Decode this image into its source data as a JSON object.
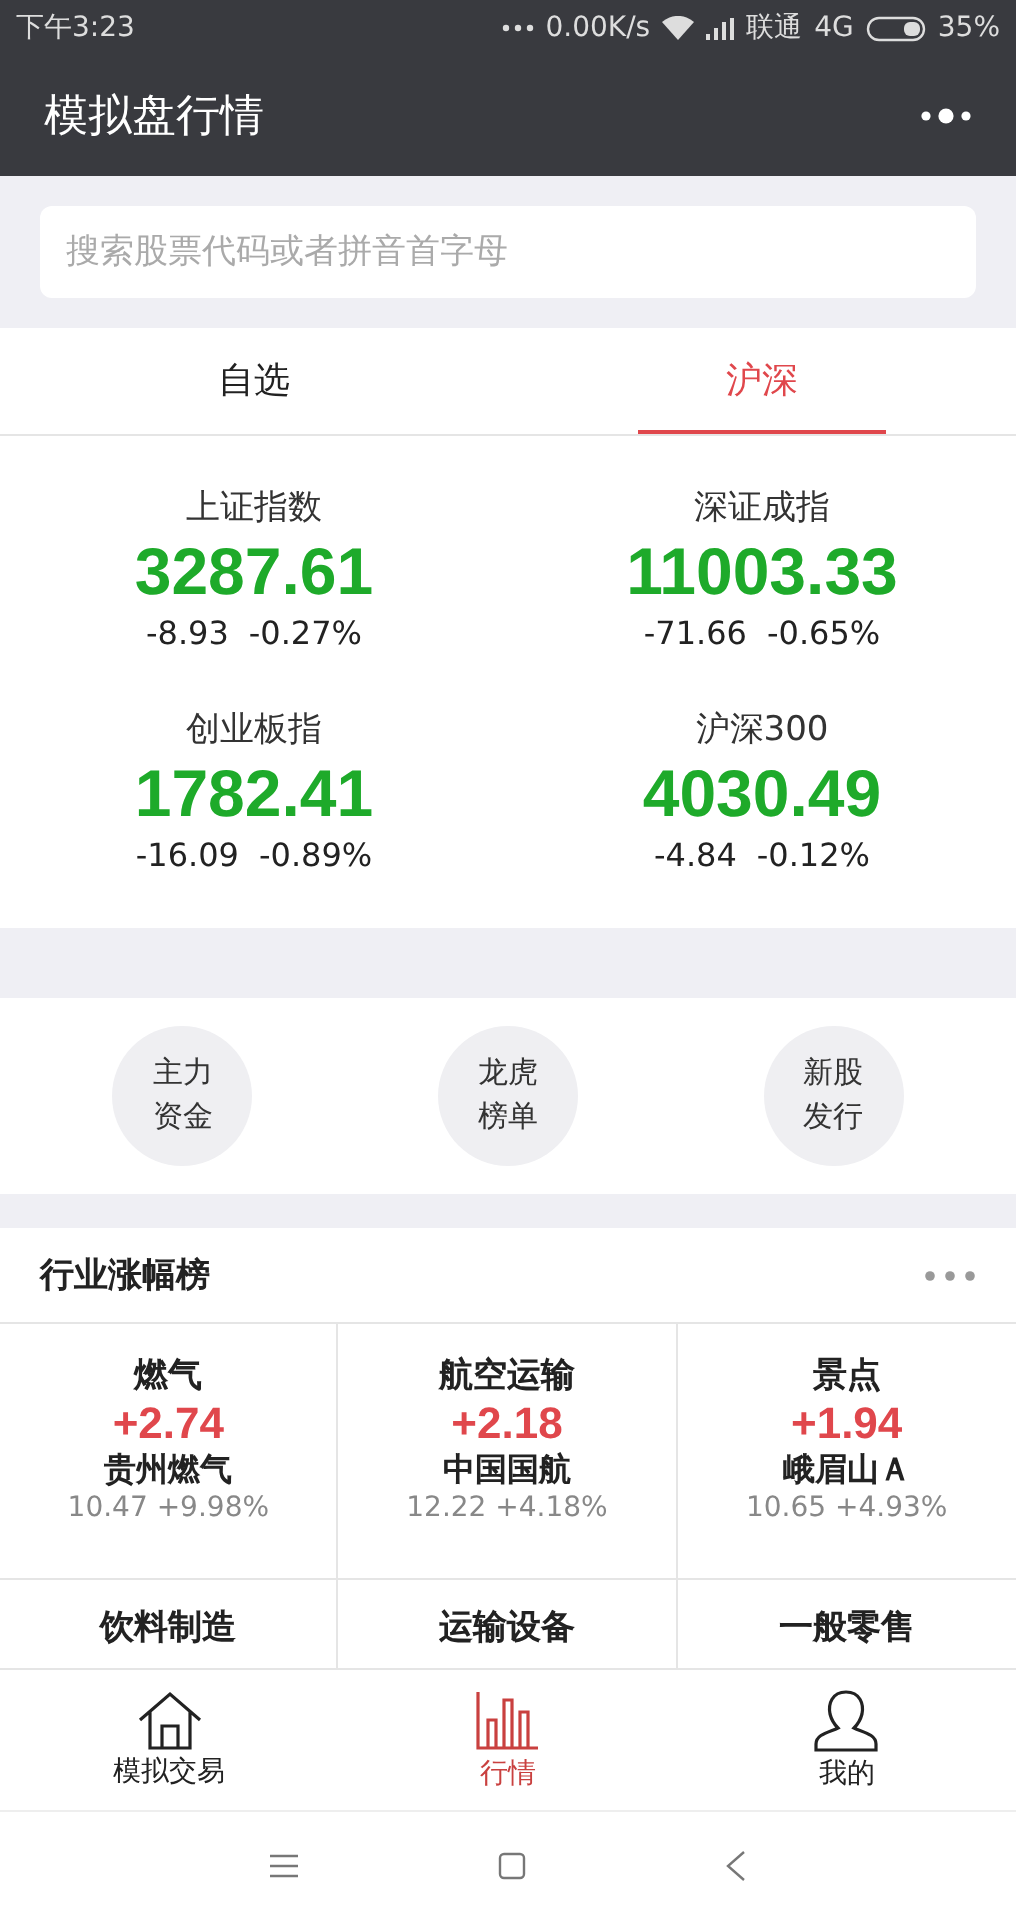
{
  "status_bar": {
    "time": "下午3:23",
    "speed": "0.00K/s",
    "carrier": "联通",
    "network": "4G",
    "battery": "35%"
  },
  "window": {
    "title": "模拟盘行情"
  },
  "search": {
    "placeholder": "搜索股票代码或者拼音首字母"
  },
  "tabs": [
    {
      "label": "自选",
      "selected": false
    },
    {
      "label": "沪深",
      "selected": true
    }
  ],
  "indices": [
    {
      "name": "上证指数",
      "value": "3287.61",
      "change": "-8.93",
      "percent": "-0.27%",
      "color": "#1eaa2a"
    },
    {
      "name": "深证成指",
      "value": "11003.33",
      "change": "-71.66",
      "percent": "-0.65%",
      "color": "#1eaa2a"
    },
    {
      "name": "创业板指",
      "value": "1782.41",
      "change": "-16.09",
      "percent": "-0.89%",
      "color": "#1eaa2a"
    },
    {
      "name": "沪深300",
      "value": "4030.49",
      "change": "-4.84",
      "percent": "-0.12%",
      "color": "#1eaa2a"
    }
  ],
  "shortcuts": [
    {
      "line1": "主力",
      "line2": "资金"
    },
    {
      "line1": "龙虎",
      "line2": "榜单"
    },
    {
      "line1": "新股",
      "line2": "发行"
    }
  ],
  "industry": {
    "title": "行业涨幅榜",
    "items": [
      {
        "name": "燃气",
        "change": "+2.74",
        "color": "#e0474c",
        "leader": "贵州燃气",
        "leader_quote": "10.47 +9.98%"
      },
      {
        "name": "航空运输",
        "change": "+2.18",
        "color": "#e0474c",
        "leader": "中国国航",
        "leader_quote": "12.22 +4.18%"
      },
      {
        "name": "景点",
        "change": "+1.94",
        "color": "#e0474c",
        "leader": "峨眉山Ａ",
        "leader_quote": "10.65 +4.93%"
      },
      {
        "name": "饮料制造"
      },
      {
        "name": "运输设备"
      },
      {
        "name": "一般零售"
      }
    ]
  },
  "bottom_tabs": [
    {
      "label": "模拟交易",
      "kind": "home",
      "selected": false
    },
    {
      "label": "行情",
      "kind": "chart",
      "selected": true
    },
    {
      "label": "我的",
      "kind": "person",
      "selected": false
    }
  ]
}
